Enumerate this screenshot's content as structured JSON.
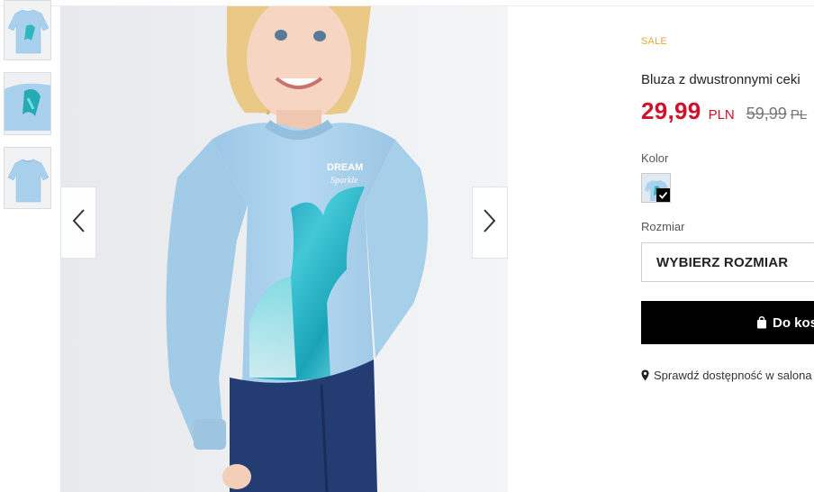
{
  "gallery": {
    "thumbnails": [
      {
        "alt": "thumb-1"
      },
      {
        "alt": "thumb-2"
      },
      {
        "alt": "thumb-3"
      }
    ],
    "prev_icon": "chevron-left-icon",
    "next_icon": "chevron-right-icon",
    "print_text_line1": "DREAM",
    "print_text_line2": "Sparkle"
  },
  "product": {
    "sale_label": "SALE",
    "title": "Bluza z dwustronnymi ceki",
    "price_current": "29,99",
    "price_currency": "PLN",
    "price_old": "59,99",
    "price_old_currency": "PL",
    "color_label": "Kolor",
    "size_label": "Rozmiar",
    "size_select_value": "WYBIERZ ROZMIAR",
    "cart_button_label": "Do kos",
    "store_check_label": "Sprawdź dostępność w salona"
  },
  "colors": {
    "sale": "#e8a93a",
    "price": "#d0112b",
    "cart_bg": "#000000",
    "sweater": "#a9d0ec"
  }
}
